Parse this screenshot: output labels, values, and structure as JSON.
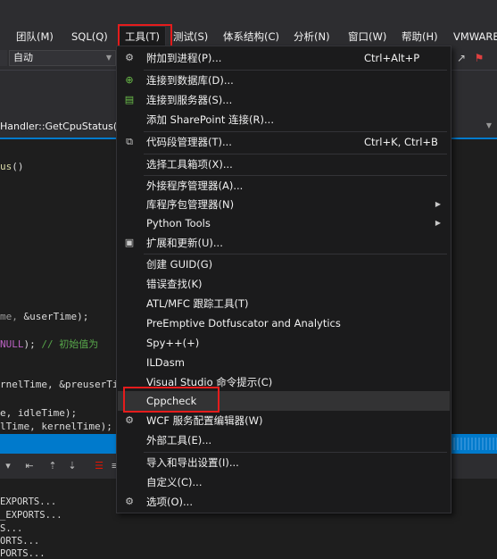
{
  "menubar": {
    "items": [
      {
        "label": "团队(M)"
      },
      {
        "label": "SQL(Q)"
      },
      {
        "label": "工具(T)"
      },
      {
        "label": "测试(S)"
      },
      {
        "label": "体系结构(C)"
      },
      {
        "label": "分析(N)"
      },
      {
        "label": "窗口(W)"
      },
      {
        "label": "帮助(H)"
      },
      {
        "label": "VMWARE"
      }
    ]
  },
  "toolbar": {
    "config_value": "自动"
  },
  "editor": {
    "tab_title": "Handler::GetCpuStatus()",
    "lines": [
      {
        "a": "us",
        "b": "()"
      },
      {
        "a": "me, ",
        "b": "&userTime);"
      },
      {
        "a": "NULL",
        "b": "); ",
        "c": "// 初始值为"
      },
      {
        "a": "rnelTime, &preuserTi"
      },
      {
        "a": "e, idleTime);"
      },
      {
        "a": "lTime, kernelTime);"
      }
    ]
  },
  "output": {
    "lines": [
      "EXPORTS...",
      "_EXPORTS...",
      "S...",
      "ORTS...",
      "PORTS..."
    ]
  },
  "tools_menu": {
    "items": [
      {
        "label": "附加到进程(P)...",
        "shortcut": "Ctrl+Alt+P",
        "icon": "attach-process-icon"
      },
      {
        "label": "连接到数据库(D)...",
        "icon": "connect-database-icon"
      },
      {
        "label": "连接到服务器(S)...",
        "icon": "connect-server-icon"
      },
      {
        "label": "添加 SharePoint 连接(R)..."
      },
      {
        "label": "代码段管理器(T)...",
        "shortcut": "Ctrl+K, Ctrl+B",
        "icon": "snippet-manager-icon"
      },
      {
        "label": "选择工具箱项(X)..."
      },
      {
        "label": "外接程序管理器(A)..."
      },
      {
        "label": "库程序包管理器(N)",
        "submenu": true
      },
      {
        "label": "Python Tools",
        "submenu": true
      },
      {
        "label": "扩展和更新(U)...",
        "icon": "extensions-icon"
      },
      {
        "label": "创建 GUID(G)"
      },
      {
        "label": "错误查找(K)"
      },
      {
        "label": "ATL/MFC 跟踪工具(T)"
      },
      {
        "label": "PreEmptive Dotfuscator and Analytics"
      },
      {
        "label": "Spy++(+)"
      },
      {
        "label": "ILDasm"
      },
      {
        "label": "Visual Studio 命令提示(C)"
      },
      {
        "label": "Cppcheck"
      },
      {
        "label": "WCF 服务配置编辑器(W)",
        "icon": "wcf-gear-icon"
      },
      {
        "label": "外部工具(E)..."
      },
      {
        "label": "导入和导出设置(I)..."
      },
      {
        "label": "自定义(C)..."
      },
      {
        "label": "选项(O)...",
        "icon": "options-gear-icon"
      }
    ]
  }
}
